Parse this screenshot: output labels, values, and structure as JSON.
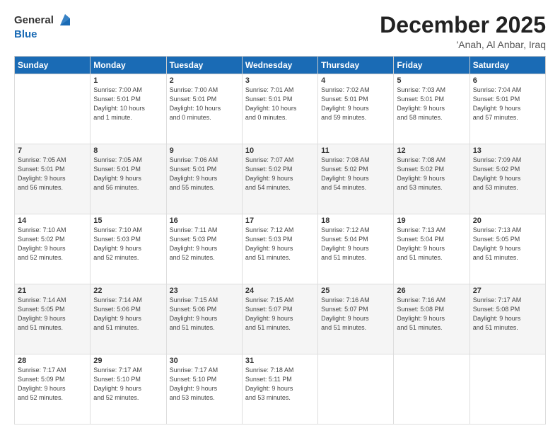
{
  "header": {
    "logo_line1": "General",
    "logo_line2": "Blue",
    "month_title": "December 2025",
    "location": "'Anah, Al Anbar, Iraq"
  },
  "weekdays": [
    "Sunday",
    "Monday",
    "Tuesday",
    "Wednesday",
    "Thursday",
    "Friday",
    "Saturday"
  ],
  "weeks": [
    [
      {
        "day": "",
        "info": ""
      },
      {
        "day": "1",
        "info": "Sunrise: 7:00 AM\nSunset: 5:01 PM\nDaylight: 10 hours\nand 1 minute."
      },
      {
        "day": "2",
        "info": "Sunrise: 7:00 AM\nSunset: 5:01 PM\nDaylight: 10 hours\nand 0 minutes."
      },
      {
        "day": "3",
        "info": "Sunrise: 7:01 AM\nSunset: 5:01 PM\nDaylight: 10 hours\nand 0 minutes."
      },
      {
        "day": "4",
        "info": "Sunrise: 7:02 AM\nSunset: 5:01 PM\nDaylight: 9 hours\nand 59 minutes."
      },
      {
        "day": "5",
        "info": "Sunrise: 7:03 AM\nSunset: 5:01 PM\nDaylight: 9 hours\nand 58 minutes."
      },
      {
        "day": "6",
        "info": "Sunrise: 7:04 AM\nSunset: 5:01 PM\nDaylight: 9 hours\nand 57 minutes."
      }
    ],
    [
      {
        "day": "7",
        "info": "Sunrise: 7:05 AM\nSunset: 5:01 PM\nDaylight: 9 hours\nand 56 minutes."
      },
      {
        "day": "8",
        "info": "Sunrise: 7:05 AM\nSunset: 5:01 PM\nDaylight: 9 hours\nand 56 minutes."
      },
      {
        "day": "9",
        "info": "Sunrise: 7:06 AM\nSunset: 5:01 PM\nDaylight: 9 hours\nand 55 minutes."
      },
      {
        "day": "10",
        "info": "Sunrise: 7:07 AM\nSunset: 5:02 PM\nDaylight: 9 hours\nand 54 minutes."
      },
      {
        "day": "11",
        "info": "Sunrise: 7:08 AM\nSunset: 5:02 PM\nDaylight: 9 hours\nand 54 minutes."
      },
      {
        "day": "12",
        "info": "Sunrise: 7:08 AM\nSunset: 5:02 PM\nDaylight: 9 hours\nand 53 minutes."
      },
      {
        "day": "13",
        "info": "Sunrise: 7:09 AM\nSunset: 5:02 PM\nDaylight: 9 hours\nand 53 minutes."
      }
    ],
    [
      {
        "day": "14",
        "info": "Sunrise: 7:10 AM\nSunset: 5:02 PM\nDaylight: 9 hours\nand 52 minutes."
      },
      {
        "day": "15",
        "info": "Sunrise: 7:10 AM\nSunset: 5:03 PM\nDaylight: 9 hours\nand 52 minutes."
      },
      {
        "day": "16",
        "info": "Sunrise: 7:11 AM\nSunset: 5:03 PM\nDaylight: 9 hours\nand 52 minutes."
      },
      {
        "day": "17",
        "info": "Sunrise: 7:12 AM\nSunset: 5:03 PM\nDaylight: 9 hours\nand 51 minutes."
      },
      {
        "day": "18",
        "info": "Sunrise: 7:12 AM\nSunset: 5:04 PM\nDaylight: 9 hours\nand 51 minutes."
      },
      {
        "day": "19",
        "info": "Sunrise: 7:13 AM\nSunset: 5:04 PM\nDaylight: 9 hours\nand 51 minutes."
      },
      {
        "day": "20",
        "info": "Sunrise: 7:13 AM\nSunset: 5:05 PM\nDaylight: 9 hours\nand 51 minutes."
      }
    ],
    [
      {
        "day": "21",
        "info": "Sunrise: 7:14 AM\nSunset: 5:05 PM\nDaylight: 9 hours\nand 51 minutes."
      },
      {
        "day": "22",
        "info": "Sunrise: 7:14 AM\nSunset: 5:06 PM\nDaylight: 9 hours\nand 51 minutes."
      },
      {
        "day": "23",
        "info": "Sunrise: 7:15 AM\nSunset: 5:06 PM\nDaylight: 9 hours\nand 51 minutes."
      },
      {
        "day": "24",
        "info": "Sunrise: 7:15 AM\nSunset: 5:07 PM\nDaylight: 9 hours\nand 51 minutes."
      },
      {
        "day": "25",
        "info": "Sunrise: 7:16 AM\nSunset: 5:07 PM\nDaylight: 9 hours\nand 51 minutes."
      },
      {
        "day": "26",
        "info": "Sunrise: 7:16 AM\nSunset: 5:08 PM\nDaylight: 9 hours\nand 51 minutes."
      },
      {
        "day": "27",
        "info": "Sunrise: 7:17 AM\nSunset: 5:08 PM\nDaylight: 9 hours\nand 51 minutes."
      }
    ],
    [
      {
        "day": "28",
        "info": "Sunrise: 7:17 AM\nSunset: 5:09 PM\nDaylight: 9 hours\nand 52 minutes."
      },
      {
        "day": "29",
        "info": "Sunrise: 7:17 AM\nSunset: 5:10 PM\nDaylight: 9 hours\nand 52 minutes."
      },
      {
        "day": "30",
        "info": "Sunrise: 7:17 AM\nSunset: 5:10 PM\nDaylight: 9 hours\nand 53 minutes."
      },
      {
        "day": "31",
        "info": "Sunrise: 7:18 AM\nSunset: 5:11 PM\nDaylight: 9 hours\nand 53 minutes."
      },
      {
        "day": "",
        "info": ""
      },
      {
        "day": "",
        "info": ""
      },
      {
        "day": "",
        "info": ""
      }
    ]
  ]
}
